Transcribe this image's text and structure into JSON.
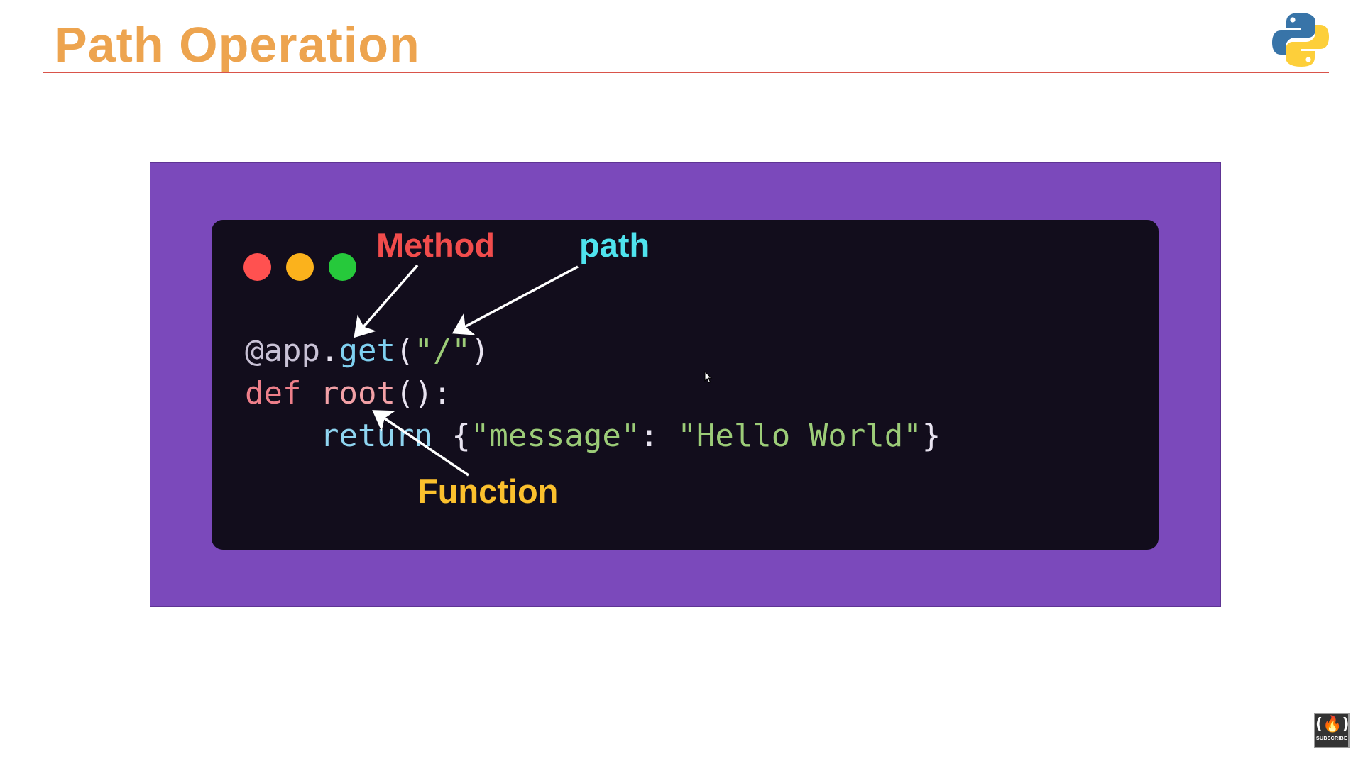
{
  "slide": {
    "title": "Path Operation"
  },
  "code": {
    "line1": {
      "decorator": "@app",
      "dot": ".",
      "method": "get",
      "open_paren": "(",
      "path_string": "\"/\"",
      "close_paren": ")"
    },
    "line2": {
      "keyword": "def",
      "function_name": "root",
      "signature_tail": "():"
    },
    "line3": {
      "indent": "    ",
      "keyword": "return",
      "open_brace": "{",
      "key_string": "\"message\"",
      "colon": ":",
      "value_string": "\"Hello World\"",
      "close_brace": "}"
    }
  },
  "annotations": {
    "method": "Method",
    "path": "path",
    "function": "Function"
  },
  "window_controls": [
    "close",
    "minimize",
    "maximize"
  ],
  "badge": {
    "glyph": "(🔥)",
    "label": "SUBSCRIBE"
  },
  "colors": {
    "title": "#eda44f",
    "title_rule": "#d9534a",
    "frame": "#7b49bb",
    "code_bg": "#120d1c",
    "method_label": "#f14c4c",
    "path_label": "#4fe3ee",
    "function_label": "#fbc02d",
    "dot_red": "#ff5150",
    "dot_yellow": "#fbb21c",
    "dot_green": "#26c93b"
  },
  "icons": {
    "logo": "python-logo-icon",
    "cursor": "mouse-cursor-icon",
    "badge": "freecodecamp-subscribe-icon"
  }
}
